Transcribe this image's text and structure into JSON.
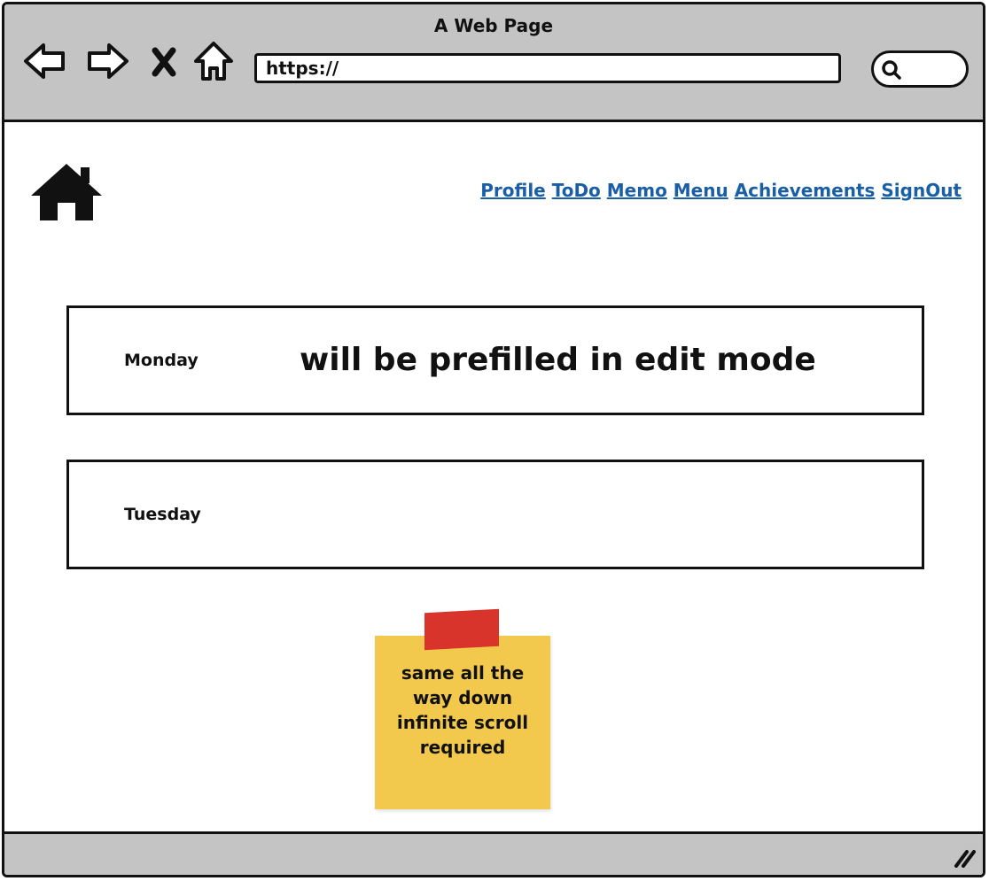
{
  "browser": {
    "title": "A Web Page",
    "url": "https://",
    "icons": {
      "back": "back-arrow-icon",
      "forward": "forward-arrow-icon",
      "stop": "close-icon",
      "home": "home-icon",
      "search": "search-icon"
    }
  },
  "header": {
    "home_icon": "home-icon",
    "nav": [
      "Profile",
      "ToDo",
      "Memo",
      "Menu",
      "Achievements",
      "SignOut"
    ],
    "link_color": "#1a5fa6"
  },
  "days": [
    {
      "label": "Monday",
      "content": "will be prefilled in edit mode"
    },
    {
      "label": "Tuesday",
      "content": ""
    }
  ],
  "note": {
    "lines": [
      "same all the",
      "way down",
      "infinite scroll",
      "required"
    ],
    "color": "#f2c94c",
    "tape_color": "#d9342b"
  },
  "status": {
    "grip_icon": "resize-grip-icon"
  }
}
